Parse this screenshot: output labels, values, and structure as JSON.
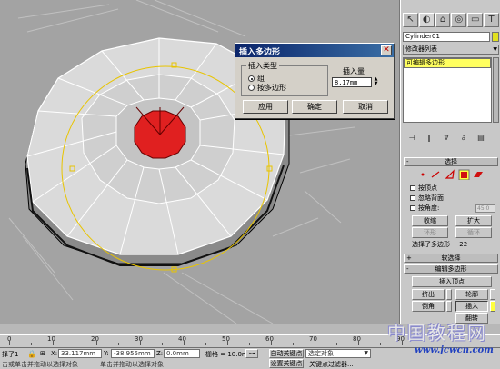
{
  "dialog": {
    "title": "插入多边形",
    "close_glyph": "✕",
    "group_label": "插入类型",
    "radio_group": "组",
    "radio_poly": "按多边形",
    "amount_label": "插入量",
    "amount_value": "8.17mm",
    "apply": "应用",
    "ok": "确定",
    "cancel": "取消"
  },
  "command_panel": {
    "tabs": [
      {
        "icon": "create-icon",
        "glyph": "↖"
      },
      {
        "icon": "modify-icon",
        "glyph": "◐"
      },
      {
        "icon": "hierarchy-icon",
        "glyph": "⌂"
      },
      {
        "icon": "motion-icon",
        "glyph": "◎"
      },
      {
        "icon": "display-icon",
        "glyph": "▭"
      },
      {
        "icon": "utilities-icon",
        "glyph": "T"
      }
    ],
    "object_name": "Cylinder01",
    "modifier_list": "修改器列表",
    "stack_item": "可编辑多边形",
    "selection": {
      "title": "选择",
      "pm": "-",
      "by_vertex": "按顶点",
      "ignore_backface": "忽略背面",
      "by_angle": "按角度:",
      "angle_value": "45.0",
      "shrink": "收缩",
      "grow": "扩大",
      "ring": "环形",
      "loop": "循环",
      "selected_text": "选择了多边形",
      "selected_count": "22"
    },
    "soft_selection": {
      "title": "软选择",
      "pm": "+"
    },
    "edit_polygons": {
      "title": "编辑多边形",
      "pm": "-",
      "insert_vertex": "插入顶点",
      "extrude": "挤出",
      "outline": "轮廓",
      "bevel": "倒角",
      "inset": "插入",
      "flip": "翻转"
    }
  },
  "ruler": {
    "labels": [
      "0",
      "10",
      "20",
      "30",
      "40",
      "50",
      "60",
      "70",
      "80",
      "90"
    ]
  },
  "status": {
    "selected": "择了1",
    "x_value": "33.117mm",
    "y_value": "-38.955mm",
    "z_value": "0.0mm",
    "grid": "栅格 = 10.0mm",
    "auto_key": "自动关键点",
    "set_key": "设置关键点",
    "selected_object": "选定对象",
    "key_filters": "关键点过滤器...",
    "prompt": "击或单击并拖动以选择对象",
    "prompt2": "单击并拖动以选择对象"
  },
  "watermark": {
    "line1": "中国教程网",
    "line2": "www.jcwcn.com"
  },
  "colors": {
    "viewport_bg": "#a3a3a3",
    "selected_face": "#e02020",
    "stack_highlight": "#ffff60",
    "title_bar": "#0a246a"
  }
}
